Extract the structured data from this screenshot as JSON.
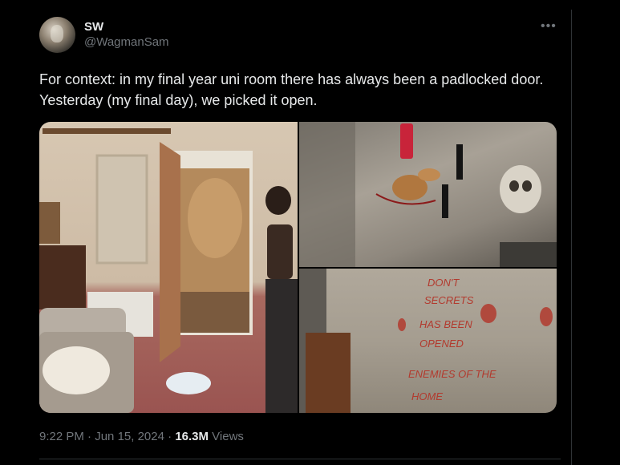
{
  "author": {
    "display_name": "SW",
    "handle": "@WagmanSam"
  },
  "tweet": {
    "text": "For context: in my final year uni room there has always been a padlocked door. Yesterday (my final day), we picked it open."
  },
  "meta": {
    "time": "9:22 PM",
    "separator1": " · ",
    "date": "Jun 15, 2024",
    "separator2": " · ",
    "views_count": "16.3M",
    "views_label": " Views"
  },
  "icons": {
    "more": "more-icon"
  },
  "photos": {
    "wall_writing": {
      "line1": "DON'T",
      "line2": "SECRETS",
      "line3": "HAS BEEN",
      "line4": "OPENED",
      "line5": "ENEMIES OF THE",
      "line6": "HOME"
    }
  },
  "colors": {
    "background": "#000000",
    "text_primary": "#e7e9ea",
    "text_secondary": "#71767b",
    "divider": "#2f3336"
  }
}
